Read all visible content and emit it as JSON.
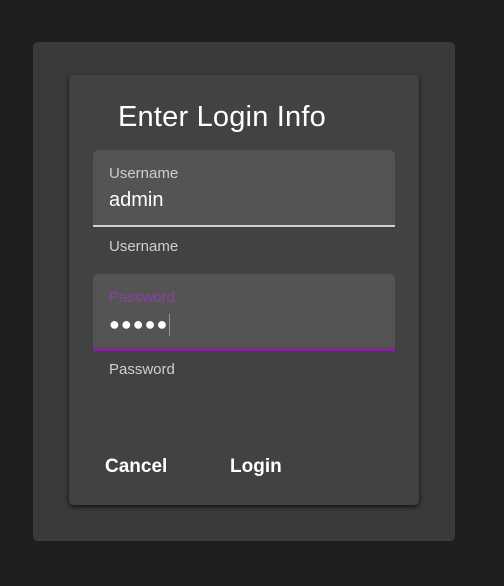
{
  "dialog": {
    "title": "Enter Login Info",
    "username": {
      "label": "Username",
      "value": "admin",
      "helper": "Username"
    },
    "password": {
      "label": "Password",
      "masked_value": "●●●●●",
      "helper": "Password"
    },
    "buttons": {
      "cancel": "Cancel",
      "login": "Login"
    }
  },
  "colors": {
    "background": "#1f1f1f",
    "card": "#424242",
    "field_fill": "#545454",
    "focus_accent": "#7b2a90"
  }
}
